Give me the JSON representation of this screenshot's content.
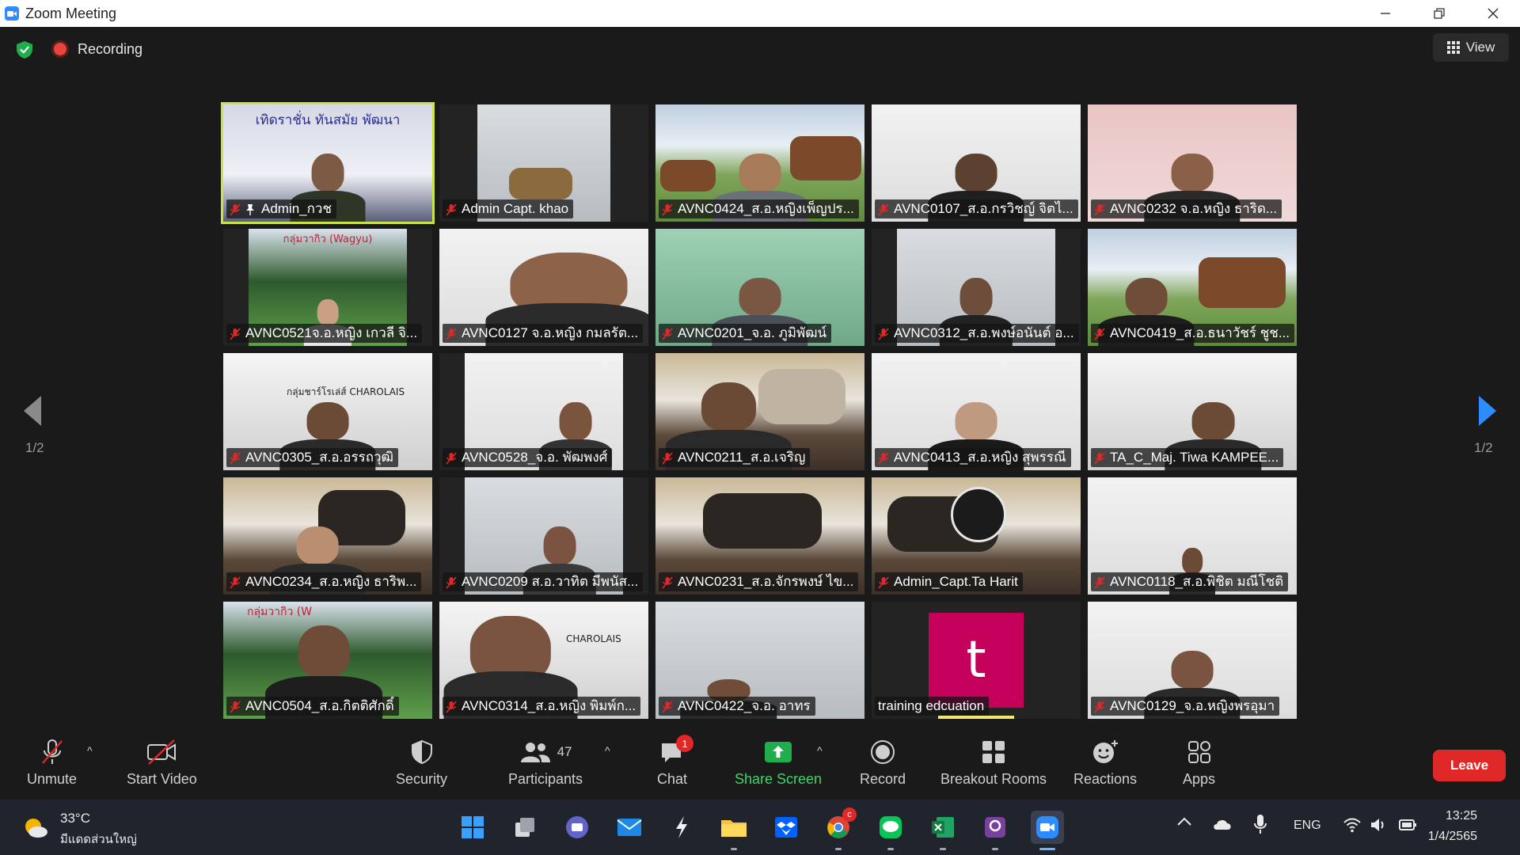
{
  "window": {
    "title": "Zoom Meeting",
    "controls": [
      "minimize",
      "restore",
      "close"
    ]
  },
  "meeting_bar": {
    "recording_label": "Recording",
    "view_label": "View"
  },
  "pagination": {
    "left_indicator": "1/2",
    "right_indicator": "1/2"
  },
  "participants": [
    {
      "name": "Admin_กวช",
      "muted": true,
      "active": true,
      "sign": "เทิดราชั่น   ทันสมัย   พัฒนา"
    },
    {
      "name": "Admin Capt. khao",
      "muted": true
    },
    {
      "name": "AVNC0424_ส.อ.หญิงเพ็ญปร...",
      "muted": true
    },
    {
      "name": "AVNC0107_ส.อ.กรวิชญ์ จิตไ...",
      "muted": true
    },
    {
      "name": "AVNC0232 จ.อ.หญิง ธาริด...",
      "muted": true
    },
    {
      "name": "AVNC0521จ.อ.หญิง เกวลี จิ...",
      "muted": true,
      "sign": "กลุ่มวากิว (Wagyu)"
    },
    {
      "name": "AVNC0127 จ.อ.หญิง กมลรัต...",
      "muted": true
    },
    {
      "name": "AVNC0201_จ.อ. ภูมิพัฒน์",
      "muted": true
    },
    {
      "name": "AVNC0312_ส.อ.พงษ์อนันต์ อ...",
      "muted": true
    },
    {
      "name": "AVNC0419_ส.อ.ธนาวัชร์ ชูช...",
      "muted": true
    },
    {
      "name": "AVNC0305_ส.อ.อรรถวุฒิ",
      "muted": true,
      "sign": "กลุ่มชาร์โรเล่ส์ CHAROLAIS"
    },
    {
      "name": "AVNC0528_จ.อ. พัฒพงศ์",
      "muted": true
    },
    {
      "name": "AVNC0211_ส.อ.เจริญ",
      "muted": true
    },
    {
      "name": "AVNC0413_ส.อ.หญิง สุพรรณี",
      "muted": true
    },
    {
      "name": "TA_C_Maj. Tiwa KAMPEE...",
      "muted": true
    },
    {
      "name": "AVNC0234_ส.อ.หญิง ธาริพ...",
      "muted": true
    },
    {
      "name": "AVNC0209 ส.อ.วาทิต มีพนัส...",
      "muted": true
    },
    {
      "name": "AVNC0231_ส.อ.จักรพงษ์ ไข...",
      "muted": true
    },
    {
      "name": "Admin_Capt.Ta Harit",
      "muted": true
    },
    {
      "name": "AVNC0118_ส.อ.พิชิต มณีโชติ",
      "muted": true
    },
    {
      "name": "AVNC0504_ส.อ.กิตติศักดิ์",
      "muted": true,
      "sign": "กลุ่มวากิว (W"
    },
    {
      "name": "AVNC0314_ส.อ.หญิง พิมพ์ก...",
      "muted": true,
      "sign": "CHAROLAIS"
    },
    {
      "name": "AVNC0422_จ.อ. อาทร",
      "muted": true
    },
    {
      "name": "training edcuation",
      "muted": false,
      "avatar_letter": "t",
      "avatar_color": "#c4005a"
    },
    {
      "name": "AVNC0129_จ.อ.หญิงพรอุมา",
      "muted": true
    }
  ],
  "toolbar": {
    "unmute": "Unmute",
    "start_video": "Start Video",
    "security": "Security",
    "participants": "Participants",
    "participants_count": "47",
    "chat": "Chat",
    "chat_badge": "1",
    "share_screen": "Share Screen",
    "record": "Record",
    "breakout_rooms": "Breakout Rooms",
    "reactions": "Reactions",
    "apps": "Apps",
    "leave": "Leave"
  },
  "taskbar": {
    "weather_temp": "33°C",
    "weather_desc": "มีแดดส่วนใหญ่",
    "language": "ENG",
    "time": "13:25",
    "date": "1/4/2565",
    "apps": [
      "windows-start",
      "task-view",
      "teams-chat",
      "mail",
      "app-x",
      "file-explorer",
      "dropbox",
      "chrome",
      "line",
      "excel",
      "pdf-app",
      "zoom"
    ]
  },
  "colors": {
    "accent_blue": "#2d8cff",
    "active_speaker": "#c9e44a",
    "leave_red": "#e02828",
    "share_green": "#3fd36a"
  }
}
